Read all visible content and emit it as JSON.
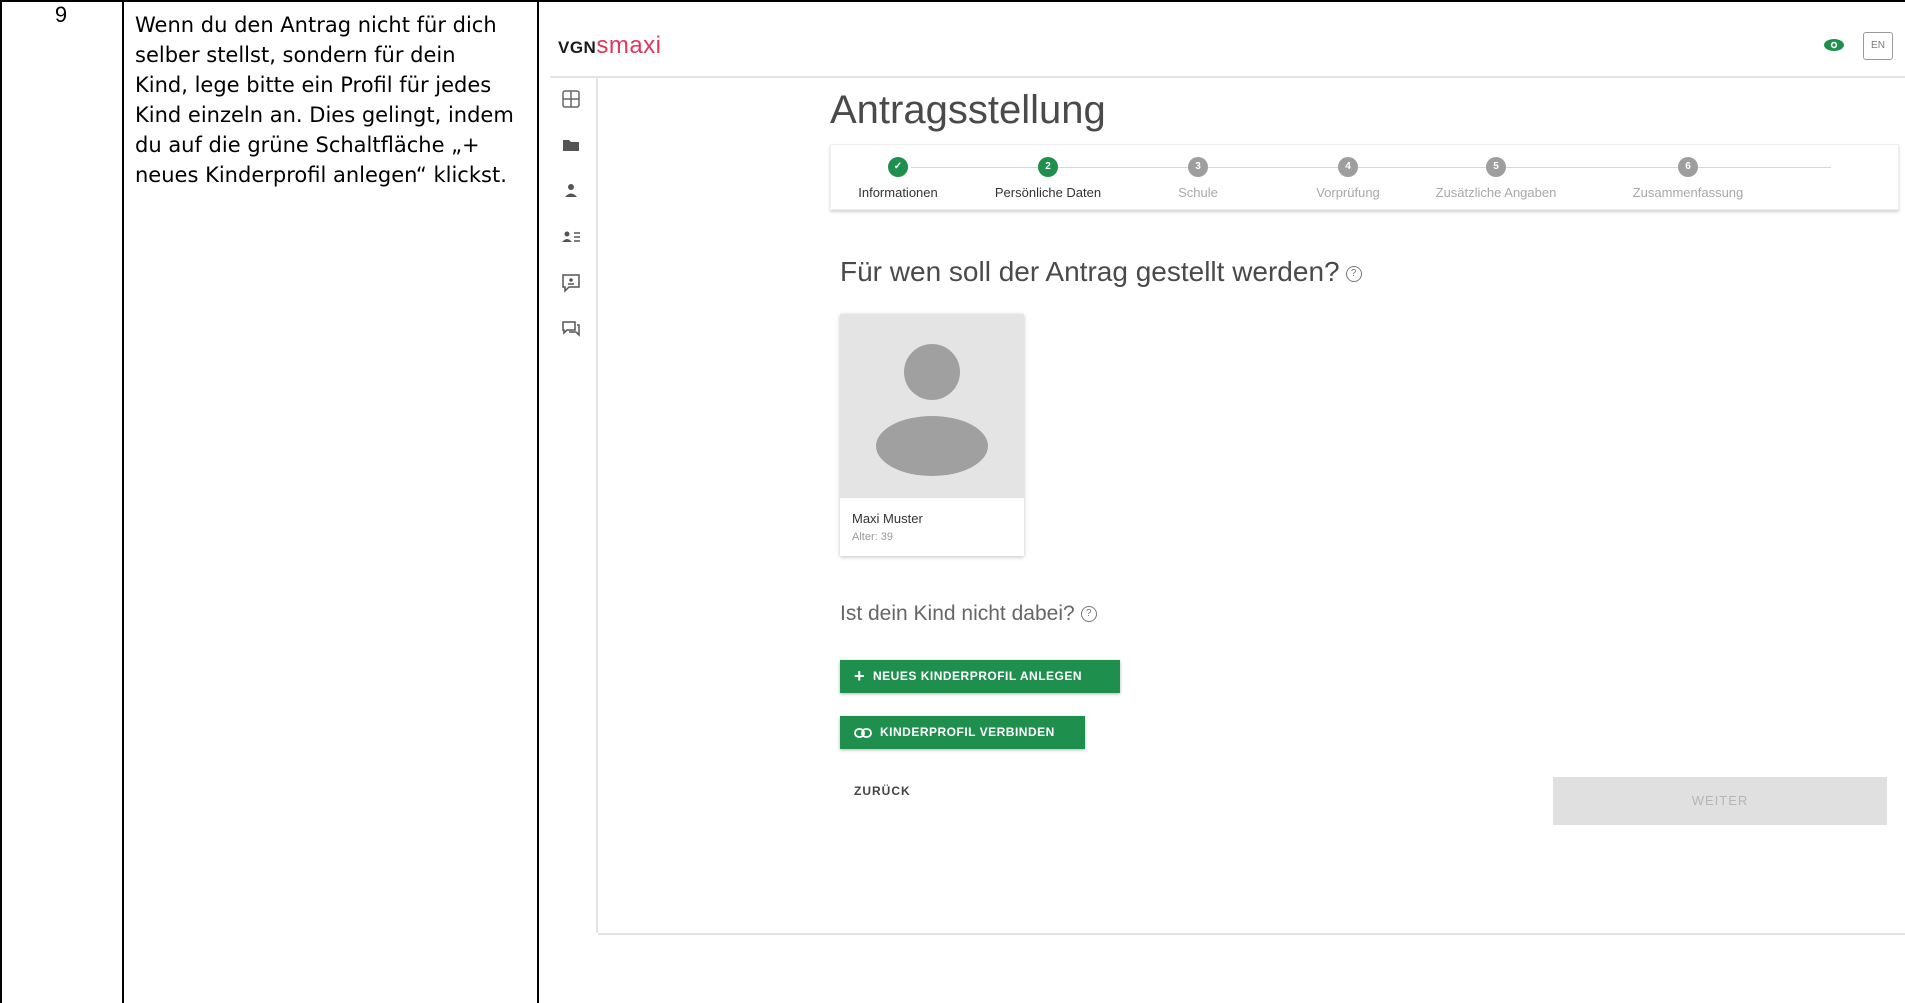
{
  "row": {
    "number": "9",
    "instruction": "Wenn du den Antrag nicht für dich selber stellst, sondern für dein Kind, lege bitte ein Profil für jedes Kind einzeln an. Dies gelingt, indem du auf die grüne Schaltfläche „+ neues Kinderprofil anlegen“ klickst."
  },
  "app": {
    "logo_vgn": "VGN",
    "logo_smaxi": "smaxi",
    "lang_label": "EN",
    "accent_color": "#1f8f4e",
    "brand_color": "#e2365d"
  },
  "sidebar": {
    "icons": [
      "dashboard-icon",
      "folder-icon",
      "person-icon",
      "person-list-icon",
      "feedback-icon",
      "chat-icon"
    ]
  },
  "page": {
    "title": "Antragsstellung",
    "steps": [
      {
        "num": "✓",
        "label": "Informationen",
        "state": "done"
      },
      {
        "num": "2",
        "label": "Persönliche Daten",
        "state": "active"
      },
      {
        "num": "3",
        "label": "Schule",
        "state": "pending"
      },
      {
        "num": "4",
        "label": "Vorprüfung",
        "state": "pending"
      },
      {
        "num": "5",
        "label": "Zusätzliche Angaben",
        "state": "pending"
      },
      {
        "num": "6",
        "label": "Zusammenfassung",
        "state": "pending"
      }
    ],
    "question": "Für wen soll der Antrag gestellt werden?",
    "profile": {
      "name": "Maxi Muster",
      "age": "Alter: 39"
    },
    "child_question": "Ist dein Kind nicht dabei?",
    "new_child_button": "NEUES KINDERPROFIL ANLEGEN",
    "link_child_button": "KINDERPROFIL VERBINDEN",
    "back_button": "ZURÜCK",
    "next_button": "WEITER"
  }
}
